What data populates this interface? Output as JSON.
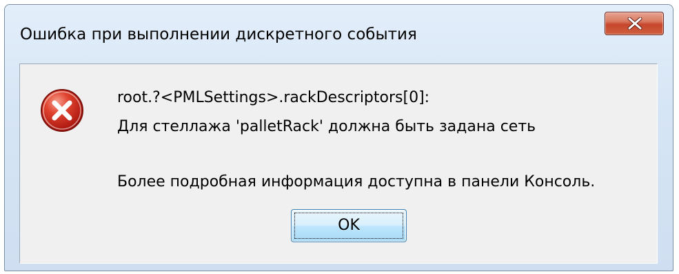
{
  "dialog": {
    "title": "Ошибка при выполнении дискретного события",
    "icon": "error-icon",
    "close_icon": "close-icon",
    "message_lines": [
      "root.?<PMLSettings>.rackDescriptors[0]:",
      "Для стеллажа 'palletRack' должна быть задана сеть",
      "Более подробная информация доступна в панели Консоль."
    ],
    "ok_label": "OK",
    "colors": {
      "error_red": "#c9231b",
      "close_red": "#c6462c",
      "client_bg": "#f0f0f0",
      "frame_bg": "#d6e5f5"
    }
  }
}
